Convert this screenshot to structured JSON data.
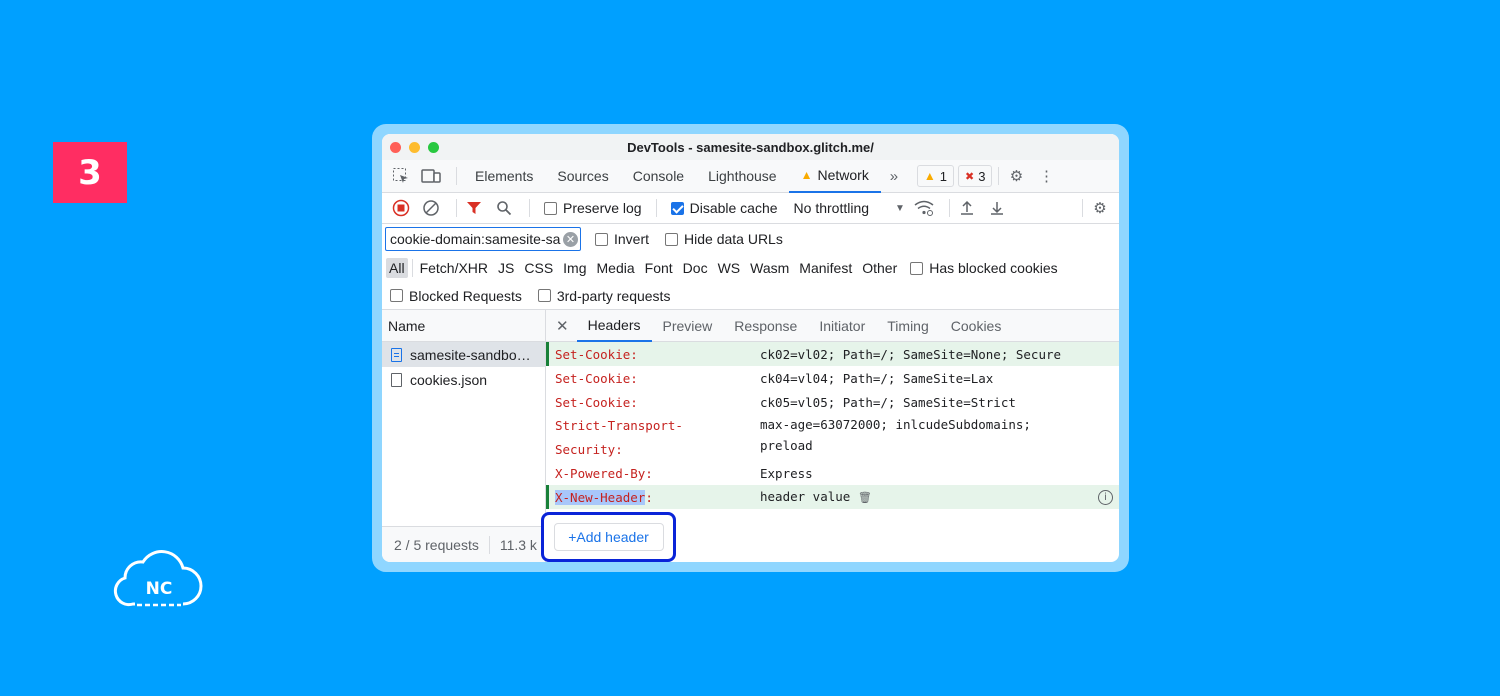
{
  "step": {
    "number": "3"
  },
  "logo": {
    "text": "NC"
  },
  "window": {
    "title": "DevTools - samesite-sandbox.glitch.me/"
  },
  "tabs": [
    "Elements",
    "Sources",
    "Console",
    "Lighthouse",
    "Network"
  ],
  "issues": {
    "warnings": "1",
    "errors": "3"
  },
  "toolbar": {
    "preserve_log": "Preserve log",
    "disable_cache": "Disable cache",
    "throttling": "No throttling"
  },
  "filter": {
    "value": "cookie-domain:samesite-sa",
    "invert": "Invert",
    "hide_data_urls": "Hide data URLs"
  },
  "types": [
    "All",
    "Fetch/XHR",
    "JS",
    "CSS",
    "Img",
    "Media",
    "Font",
    "Doc",
    "WS",
    "Wasm",
    "Manifest",
    "Other"
  ],
  "has_blocked_cookies": "Has blocked cookies",
  "blocked_requests": "Blocked Requests",
  "third_party": "3rd-party requests",
  "requests": {
    "header": "Name",
    "items": [
      "samesite-sandbo…",
      "cookies.json"
    ]
  },
  "detail_tabs": [
    "Headers",
    "Preview",
    "Response",
    "Initiator",
    "Timing",
    "Cookies"
  ],
  "headers": [
    {
      "name": "Set-Cookie:",
      "value": "ck02=vl02; Path=/; SameSite=None; Secure"
    },
    {
      "name": "Set-Cookie:",
      "value": "ck04=vl04; Path=/; SameSite=Lax"
    },
    {
      "name": "Set-Cookie:",
      "value": "ck05=vl05; Path=/; SameSite=Strict"
    },
    {
      "name1": "Strict-Transport-",
      "name2": "Security:",
      "value1": "max-age=63072000; inlcudeSubdomains;",
      "value2": "preload"
    },
    {
      "name": "X-Powered-By:",
      "value": "Express"
    },
    {
      "name": "X-New-Header",
      "suffix": ":",
      "value": "header value"
    }
  ],
  "status": {
    "requests": "2 / 5 requests",
    "size": "11.3 k"
  },
  "add_header": "+Add header",
  "colors": {
    "background": "#00a0ff",
    "badge": "#ff2d62",
    "accent": "#1a73e8",
    "highlight_border": "#0a24d8"
  }
}
